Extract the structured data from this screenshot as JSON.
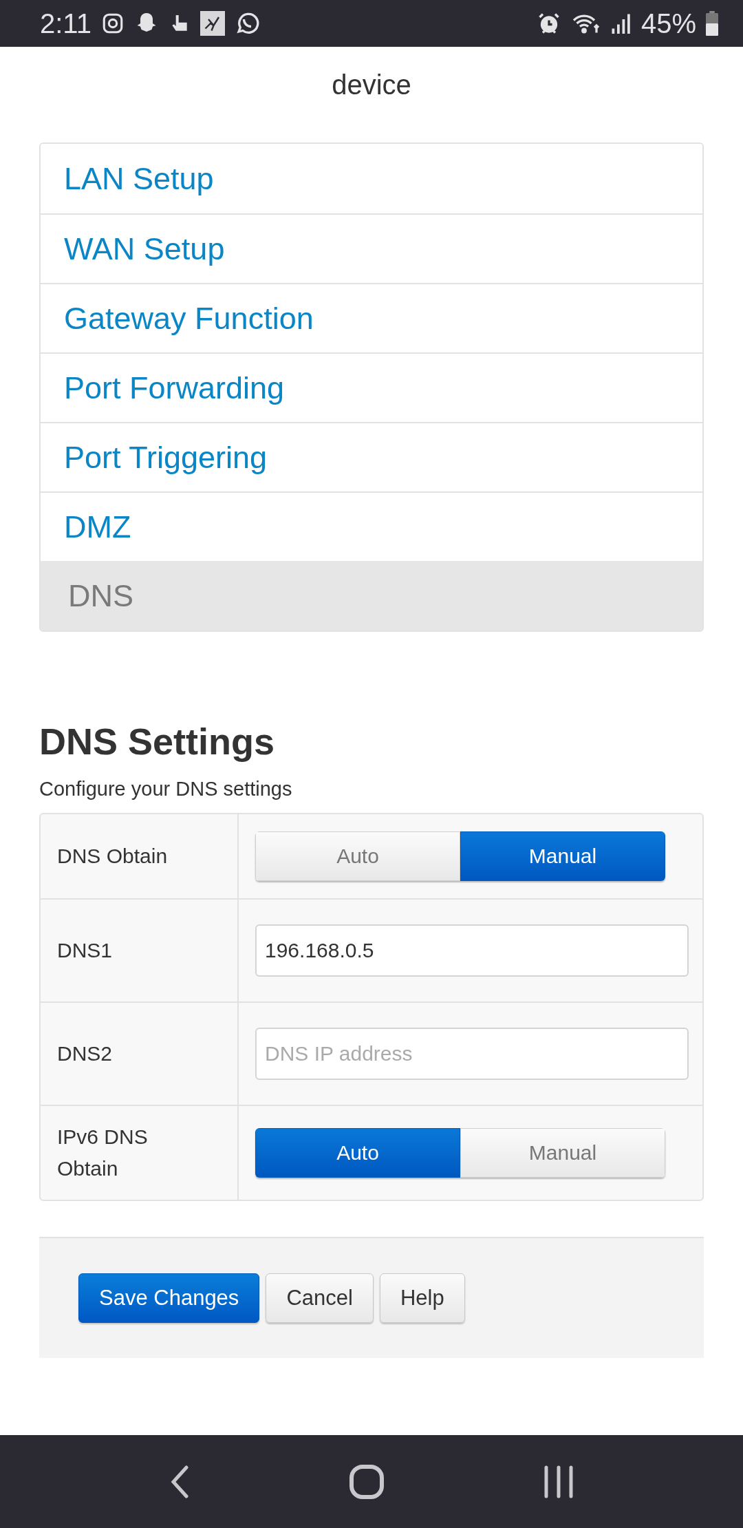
{
  "status_bar": {
    "time": "2:11",
    "battery": "45%"
  },
  "description": "device",
  "menu": {
    "items": [
      {
        "label": "LAN Setup",
        "selected": false
      },
      {
        "label": "WAN Setup",
        "selected": false
      },
      {
        "label": "Gateway Function",
        "selected": false
      },
      {
        "label": "Port Forwarding",
        "selected": false
      },
      {
        "label": "Port Triggering",
        "selected": false
      },
      {
        "label": "DMZ",
        "selected": false
      },
      {
        "label": "DNS",
        "selected": true
      }
    ]
  },
  "dns_settings": {
    "title": "DNS Settings",
    "subtitle": "Configure your DNS settings",
    "rows": [
      {
        "kind": "toggle",
        "label": "DNS Obtain",
        "options": [
          {
            "label": "Auto",
            "selected": false
          },
          {
            "label": "Manual",
            "selected": true
          }
        ]
      },
      {
        "kind": "input",
        "label": "DNS1",
        "value": "196.168.0.5"
      },
      {
        "kind": "input",
        "label": "DNS2",
        "placeholder": "DNS IP address"
      },
      {
        "kind": "toggle",
        "label": "IPv6 DNS Obtain",
        "options": [
          {
            "label": "Auto",
            "selected": true
          },
          {
            "label": "Manual",
            "selected": false
          }
        ]
      }
    ]
  },
  "buttons": [
    {
      "label": "Save Changes",
      "kind": "primary"
    },
    {
      "label": "Cancel",
      "kind": "default"
    },
    {
      "label": "Help",
      "kind": "default"
    }
  ]
}
